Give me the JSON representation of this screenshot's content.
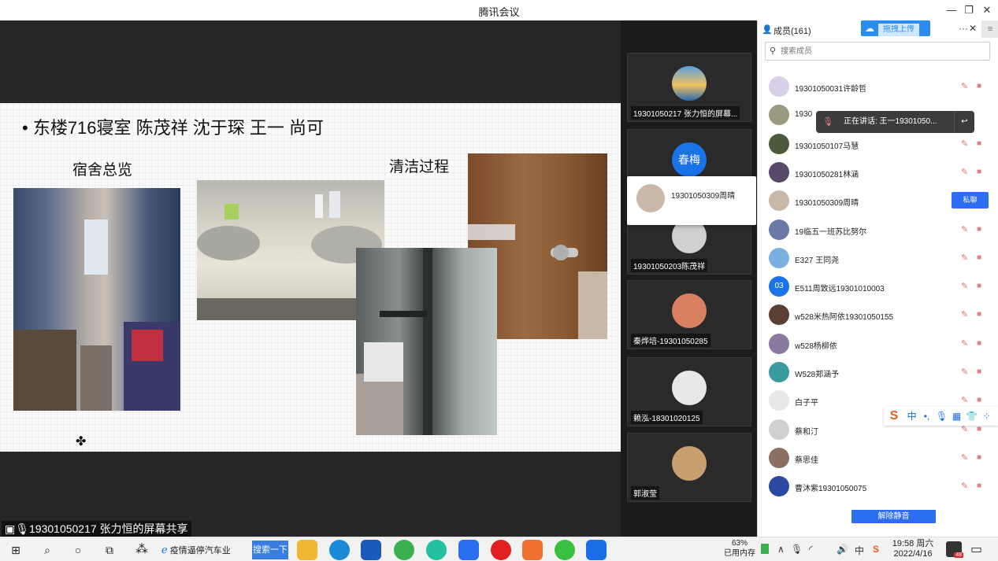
{
  "window": {
    "title": "腾讯会议",
    "minimize": "—",
    "restore": "❐",
    "close": "✕"
  },
  "slide": {
    "heading": "• 东楼716寝室 陈茂祥 沈于琛 王一 尚可",
    "caption_overview": "宿舍总览",
    "caption_cleaning": "清洁过程"
  },
  "share_label": "19301050217 张力恒的屏幕共享",
  "videos": [
    {
      "name": "19301050217 张力恒的屏幕..."
    },
    {
      "name": "春梅"
    },
    {
      "name": "19301050203陈茂祥"
    },
    {
      "name": "秦烨培-19301050285"
    },
    {
      "name": "赖泓-18301020125"
    },
    {
      "name": "郭淑莹"
    }
  ],
  "popup_name": "19301050309周晴",
  "panel": {
    "title": "成员(161)",
    "upload_label": "拖拽上传",
    "more": "···",
    "close": "✕",
    "menu": "≡",
    "search_placeholder": "搜索成员",
    "chat_label": "私聊",
    "unmute_all": "解除静音",
    "speaking": "正在讲话: 王一19301050..."
  },
  "members": [
    {
      "name": "19301050031许龄哲",
      "color": "#d8d0e8"
    },
    {
      "name": "1930",
      "color": "#9a9a80"
    },
    {
      "name": "19301050107马慧",
      "color": "#4a5a3a"
    },
    {
      "name": "19301050281林涵",
      "color": "#5a4a6a"
    },
    {
      "name": "19301050309周晴",
      "color": "#c9b8a8"
    },
    {
      "name": "19临五一班苏比努尔",
      "color": "#6a7aa8"
    },
    {
      "name": "E327 王同尧",
      "color": "#7ab0e0"
    },
    {
      "name": "E511周致远19301010003",
      "color": "#1a73e8",
      "initials": "03"
    },
    {
      "name": "w528米热阿依19301050155",
      "color": "#5a4030"
    },
    {
      "name": "w528杨柳依",
      "color": "#8a7aa0"
    },
    {
      "name": "W528郑涵予",
      "color": "#3a9aa0"
    },
    {
      "name": "白子平",
      "color": "#e8e8e8"
    },
    {
      "name": "蔡和汀",
      "color": "#d0d0d0"
    },
    {
      "name": "蔡思佳",
      "color": "#8a7060"
    },
    {
      "name": "曹沐紫19301050075",
      "color": "#2a4aa0"
    }
  ],
  "ime": {
    "logo": "S",
    "lang": "中",
    "punct": "•,",
    "voice": "🎙",
    "keyboard": "▦",
    "skin": "👕",
    "tools": "⁘"
  },
  "taskbar": {
    "start": "⊞",
    "search": "⌕",
    "cortana": "○",
    "taskview": "⧉",
    "pinned_logo": "⁂",
    "news": "疫情逼停汽车业",
    "search_btn": "搜索一下",
    "memory_pct": "63%",
    "memory_label": "已用内存",
    "tray_up": "∧",
    "tray_mic": "🎙",
    "tray_wifi": "◜",
    "tray_vol": "🔊",
    "tray_ime": "中",
    "tray_sogou": "S",
    "time": "19:58 周六",
    "date": "2022/4/16",
    "notif_count": "48",
    "action_center": "▭"
  },
  "colors": {
    "accent": "#2b6ef0",
    "dark_bg": "#262626"
  }
}
